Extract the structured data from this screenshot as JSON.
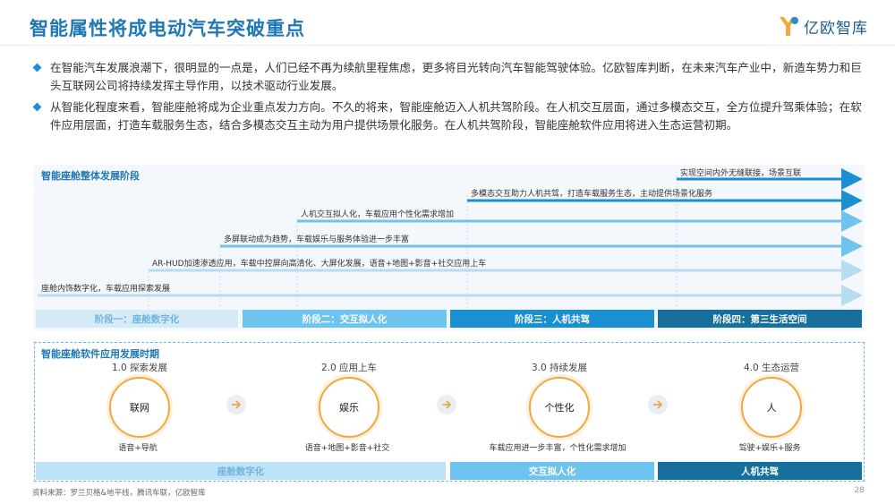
{
  "header": {
    "title": "智能属性将成电动汽车突破重点",
    "logo_text": "亿欧智库"
  },
  "bullets": [
    "在智能汽车发展浪潮下，很明显的一点是，人们已经不再为续航里程焦虑，更多将目光转向汽车智能驾驶体验。亿欧智库判断，在未来汽车产业中，新造车势力和巨头互联网公司将持续发挥主导作用，以技术驱动行业发展。",
    "从智能化程度来看，智能座舱将成为企业重点发力方向。不久的将来，智能座舱迈入人机共驾阶段。在人机交互层面，通过多模态交互，全方位提升驾乘体验；在软件应用层面，打造车载服务生态，结合多模态交互主动为用户提供场景化服务。在人机共驾阶段，智能座舱软件应用将进入生态运营初期。"
  ],
  "stages_section": {
    "title": "智能座舱整体发展阶段",
    "arrows": [
      "实现空间内外无缝联接，场景互联",
      "多模态交互助力人机共驾，打造车载服务生态，主动提供场景化服务",
      "人机交互拟人化，车载应用个性化需求增加",
      "多屏联动成为趋势，车载娱乐与服务体验进一步丰富",
      "AR-HUD加速渗透应用，车载中控屏向高清化、大屏化发展，语音+地图+影音+社交应用上车",
      "座舱内饰数字化，车载应用探索发展"
    ],
    "stages": [
      "阶段一：座舱数字化",
      "阶段二：交互拟人化",
      "阶段三：人机共驾",
      "阶段四：第三生活空间"
    ]
  },
  "software_section": {
    "title": "智能座舱软件应用发展时期",
    "phases": [
      {
        "label": "1.0 探索发展",
        "circle": "联网",
        "caption": "语音+导航"
      },
      {
        "label": "2.0 应用上车",
        "circle": "娱乐",
        "caption": "语音+地图+影音+社交"
      },
      {
        "label": "3.0 持续发展",
        "circle": "个性化",
        "caption": "车载应用进一步丰富，个性化需求增加"
      },
      {
        "label": "4.0 生态运营",
        "circle": "人",
        "caption": "驾驶+娱乐+服务"
      }
    ],
    "bottom_bars": [
      "座舱数字化",
      "交互拟人化",
      "人机共驾"
    ]
  },
  "colors": {
    "brand": "#1f78b4",
    "stage1": "#d5ebf8",
    "stage2": "#6ec4ee",
    "stage3": "#1b90d0",
    "stage4": "#176f9e",
    "circle_border": "#f0a840"
  },
  "footer": {
    "source": "资料来源：罗兰贝格&地平线，腾讯车联，亿欧智库",
    "page": "28"
  }
}
